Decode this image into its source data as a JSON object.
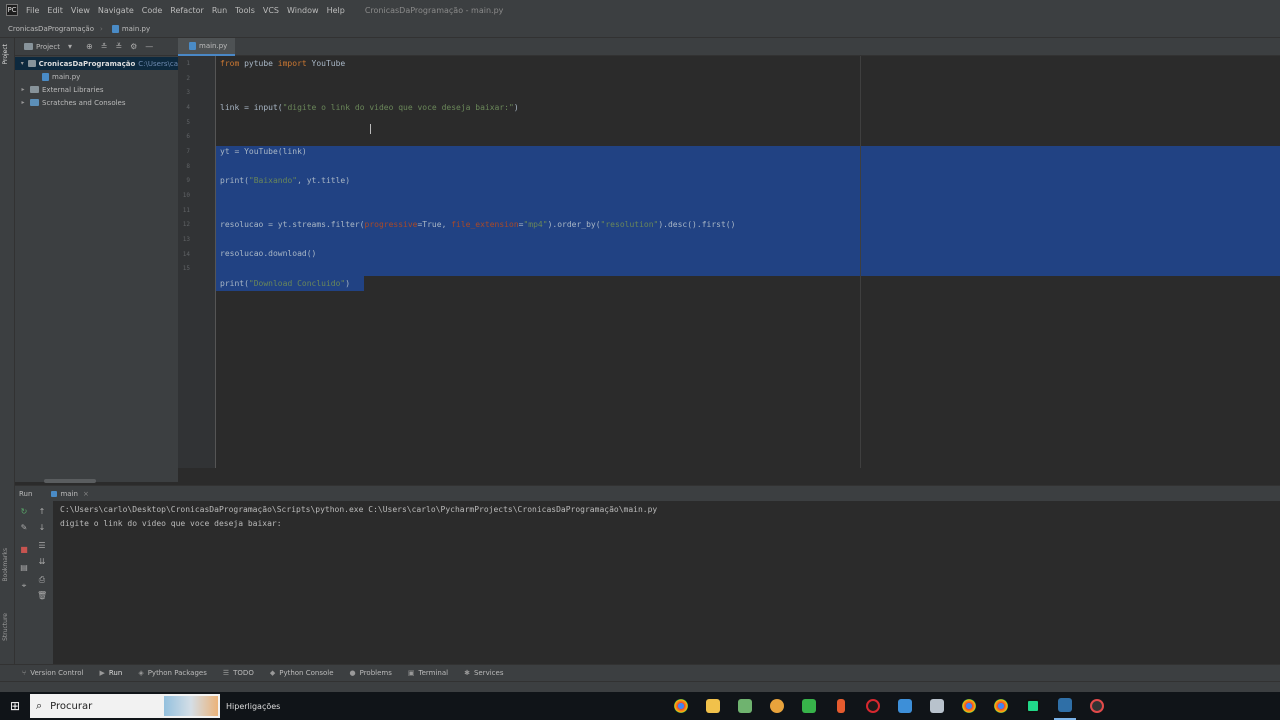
{
  "menubar": {
    "items": [
      "File",
      "Edit",
      "View",
      "Navigate",
      "Code",
      "Refactor",
      "Run",
      "Tools",
      "VCS",
      "Window",
      "Help"
    ],
    "window_title": "CronicasDaProgramação - main.py"
  },
  "navbar": {
    "project": "CronicasDaProgramação",
    "file": "main.py"
  },
  "left_strip": {
    "project_label": "Project",
    "bookmarks_label": "Bookmarks",
    "structure_label": "Structure"
  },
  "project_panel": {
    "title": "Project",
    "tree": [
      {
        "label": "CronicasDaProgramação",
        "path": "C:\\Users\\ca"
      },
      {
        "label": "main.py"
      },
      {
        "label": "External Libraries"
      },
      {
        "label": "Scratches and Consoles"
      }
    ]
  },
  "editor": {
    "tab": "main.py",
    "line_numbers": [
      "1",
      "2",
      "3",
      "4",
      "5",
      "6",
      "7",
      "8",
      "9",
      "10",
      "11",
      "12",
      "13",
      "14",
      "15"
    ],
    "code": {
      "l1_from": "from",
      "l1_mod": " pytube ",
      "l1_import": "import",
      "l1_name": " YouTube",
      "l4_pre": "link = input(",
      "l4_str": "\"digite o link do video que voce deseja baixar:\"",
      "l4_post": ")",
      "l7": "yt = YouTube(link)",
      "l9_pre": "print(",
      "l9_str": "\"Baixando\"",
      "l9_post": ", yt.title)",
      "l12_pre": "resolucao = yt.streams.filter(",
      "l12_p1": "progressive",
      "l12_v1": "=True, ",
      "l12_p2": "file_extension",
      "l12_v2": "=",
      "l12_s2": "\"mp4\"",
      "l12_mid": ").order_by(",
      "l12_s3": "\"resolution\"",
      "l12_post": ").desc().first()",
      "l14": "resolucao.download()",
      "l16_pre": "print(",
      "l16_str": "\"Download Concluido\"",
      "l16_post": ")"
    }
  },
  "run_panel": {
    "label": "Run",
    "tab": "main",
    "console": [
      "C:\\Users\\carlo\\Desktop\\CronicasDaProgramação\\Scripts\\python.exe C:\\Users\\carlo\\PycharmProjects\\CronicasDaProgramação\\main.py",
      "digite o link do video que voce deseja baixar:"
    ]
  },
  "tool_windows": {
    "version_control": "Version Control",
    "run": "Run",
    "python_packages": "Python Packages",
    "todo": "TODO",
    "python_console": "Python Console",
    "problems": "Problems",
    "terminal": "Terminal",
    "services": "Services"
  },
  "taskbar": {
    "search_placeholder": "Procurar",
    "hiperligacoes": "Hiperligações"
  },
  "colors": {
    "selection": "#214283",
    "keyword": "#cc7832",
    "string": "#6a8759",
    "param": "#aa4926",
    "background": "#2b2b2b"
  }
}
